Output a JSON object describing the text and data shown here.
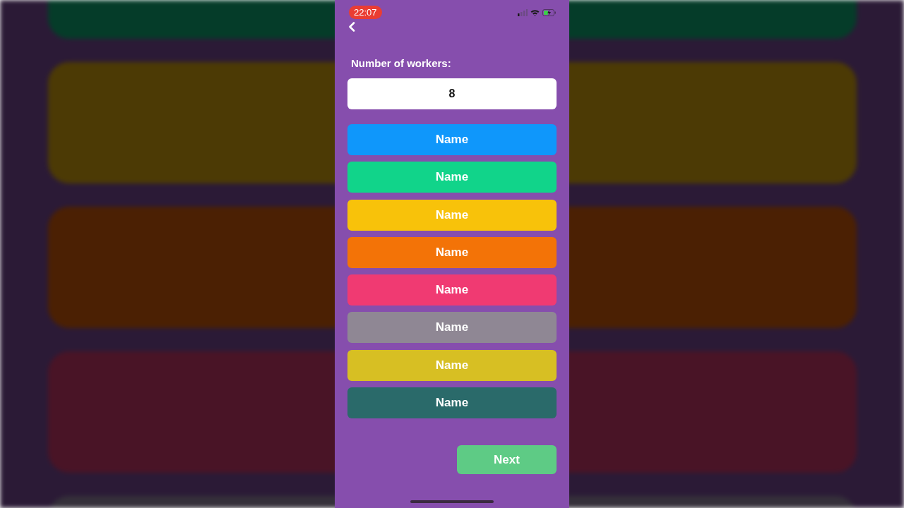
{
  "status_bar": {
    "time": "22:07"
  },
  "workers": {
    "label": "Number of workers:",
    "value": "8"
  },
  "names": [
    {
      "label": "Name",
      "color": "#0f97fb"
    },
    {
      "label": "Name",
      "color": "#11d48a"
    },
    {
      "label": "Name",
      "color": "#f8c20a"
    },
    {
      "label": "Name",
      "color": "#f37307"
    },
    {
      "label": "Name",
      "color": "#f03a72"
    },
    {
      "label": "Name",
      "color": "#8f8794"
    },
    {
      "label": "Name",
      "color": "#d7bf23"
    },
    {
      "label": "Name",
      "color": "#2a6a6a"
    }
  ],
  "next_button": {
    "label": "Next"
  }
}
